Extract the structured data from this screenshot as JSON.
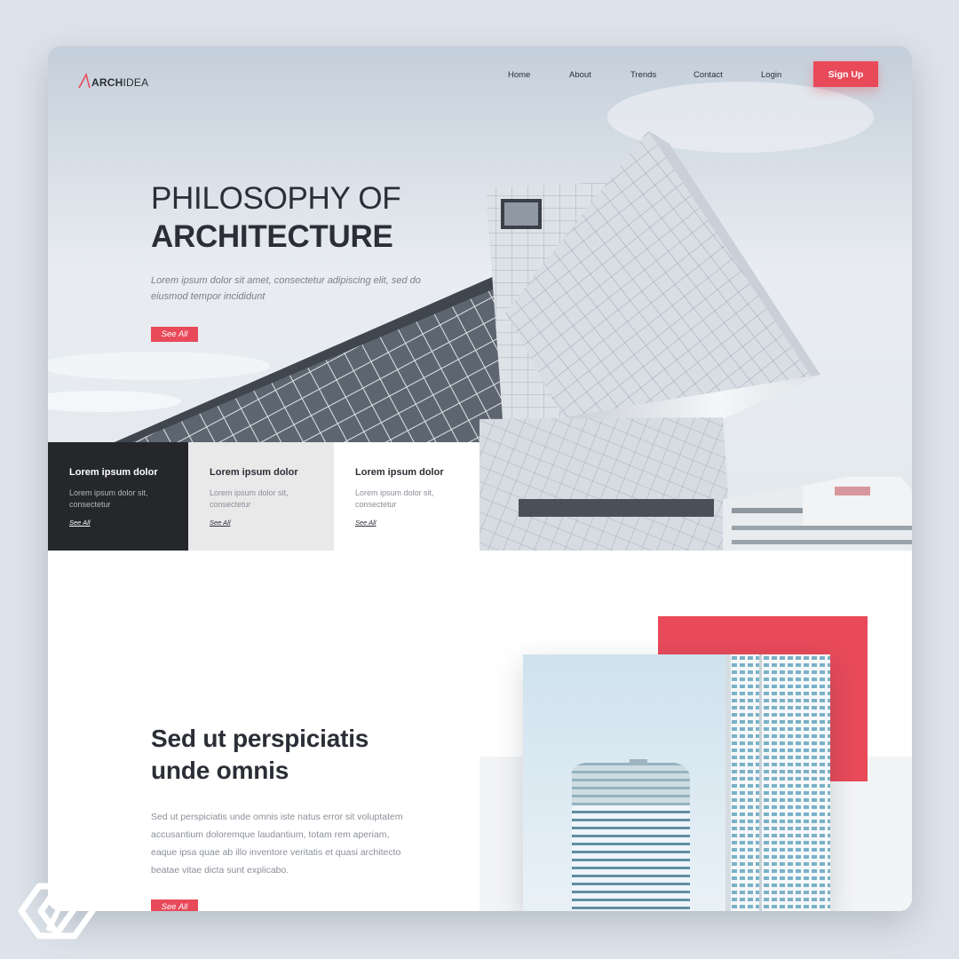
{
  "nav": {
    "logo": {
      "bold": "ARCH",
      "light": "IDEA"
    },
    "links": [
      "Home",
      "About",
      "Trends",
      "Contact",
      "Login"
    ],
    "signup_label": "Sign Up"
  },
  "hero": {
    "title_line1": "PHILOSOPHY OF",
    "title_line2": "ARCHITECTURE",
    "subtitle": "Lorem ipsum dolor sit amet, consectetur adipiscing elit, sed do eiusmod tempor incididunt",
    "cta_label": "See All"
  },
  "features": [
    {
      "title": "Lorem ipsum dolor",
      "text": "Lorem ipsum dolor sit, consectetur",
      "link": "See All"
    },
    {
      "title": "Lorem ipsum dolor",
      "text": "Lorem ipsum dolor sit, consectetur",
      "link": "See All"
    },
    {
      "title": "Lorem ipsum dolor",
      "text": "Lorem ipsum dolor sit, consectetur",
      "link": "See All"
    }
  ],
  "section2": {
    "title": "Sed ut perspiciatis unde omnis",
    "text": "Sed ut perspiciatis unde omnis iste natus error sit voluptatem accusantium doloremque laudantium, totam rem aperiam, eaque ipsa quae ab illo inventore veritatis et quasi architecto beatae vitae dicta sunt explicabo.",
    "cta_label": "See All"
  },
  "colors": {
    "accent": "#e84a5a",
    "dark_box": "#25272b",
    "light_box": "#e9e9ea",
    "text_dark": "#2b2e36",
    "page_bg": "#dde3ea"
  }
}
